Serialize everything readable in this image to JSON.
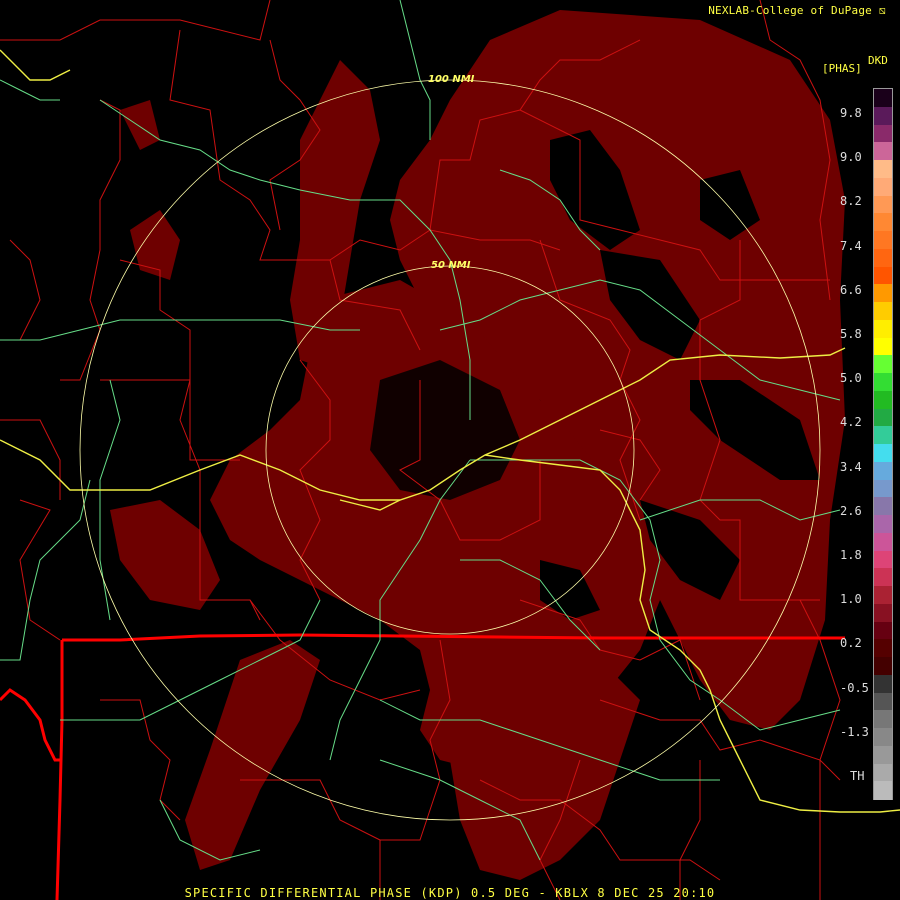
{
  "credit": "NEXLAB-College of DuPage",
  "product_code": "DKD",
  "units": "[PHAS]",
  "colorbar": {
    "ticks": [
      "9.8",
      "9.0",
      "8.2",
      "7.4",
      "6.6",
      "5.8",
      "5.0",
      "4.2",
      "3.4",
      "2.6",
      "1.8",
      "1.0",
      "0.2",
      "-0.5",
      "-1.3",
      "TH"
    ],
    "colors": [
      "#1a001a",
      "#5a1a5a",
      "#8a2a6a",
      "#cc6699",
      "#ffbb88",
      "#ffaa77",
      "#ff9955",
      "#ff8833",
      "#ff7722",
      "#ff6611",
      "#ff5500",
      "#ff9900",
      "#ffcc00",
      "#ffee00",
      "#ffff00",
      "#66ff33",
      "#33dd33",
      "#22bb22",
      "#22aa44",
      "#33cc99",
      "#44ddee",
      "#66aadd",
      "#7799cc",
      "#8877aa",
      "#aa66aa",
      "#cc5599",
      "#dd4477",
      "#cc3355",
      "#aa2233",
      "#881122",
      "#660011",
      "#550000",
      "#440000",
      "#333333",
      "#555555",
      "#777777",
      "#888888",
      "#999999",
      "#aaaaaa",
      "#bbbbbb"
    ]
  },
  "range_rings": {
    "inner": "50 NMI",
    "outer": "100 NMI"
  },
  "caption": "SPECIFIC DIFFERENTIAL PHASE (KDP) 0.5 DEG - KBLX 8 DEC 25 20:10",
  "colors": {
    "echo": "#6e0000",
    "echo_dark": "#4a0000",
    "ring": "#ffffaa",
    "county": "#cc1111",
    "state": "#ff0000",
    "road": "#66dd88",
    "interstate": "#eeee44"
  }
}
